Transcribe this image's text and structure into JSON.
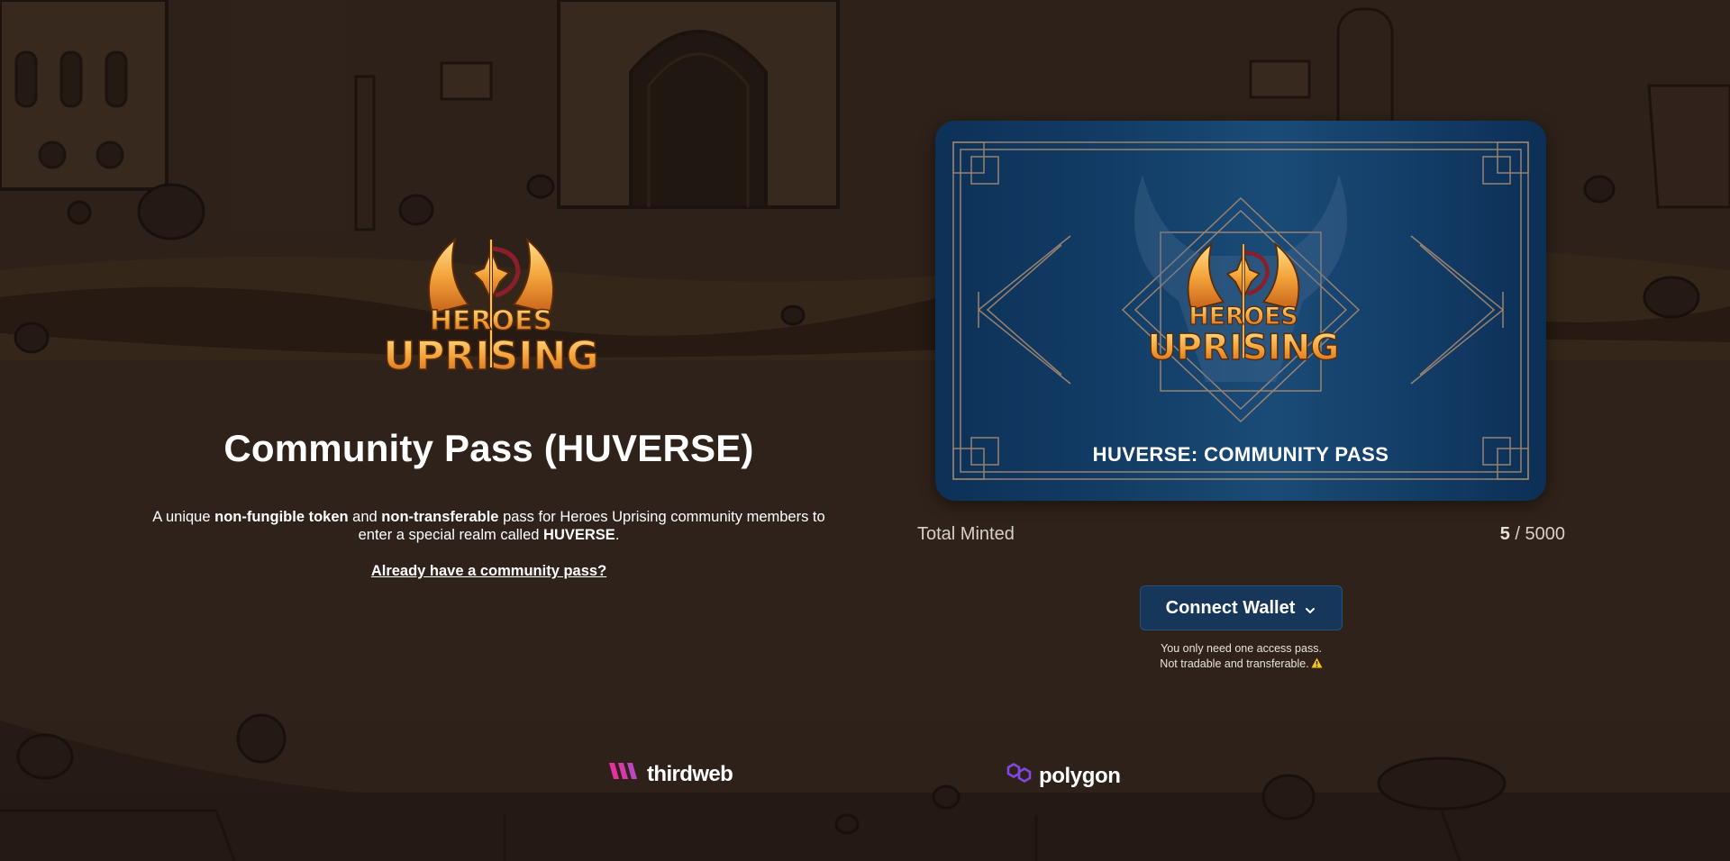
{
  "hero": {
    "logo_icon": "heroes-uprising-logo",
    "logo_text_line1": "HEROES",
    "logo_text_line2": "UPRISING",
    "title": "Community Pass (HUVERSE)",
    "description": {
      "part1": "A unique ",
      "bold1": "non-fungible token",
      "part2": " and ",
      "bold2": "non-transferable",
      "part3": " pass for Heroes Uprising community members to enter a special realm called ",
      "bold3": "HUVERSE",
      "part4": "."
    },
    "already_link": "Already have a community pass?"
  },
  "pass_card": {
    "caption": "HUVERSE: COMMUNITY PASS",
    "logo_text_line1": "HEROES",
    "logo_text_line2": "UPRISING"
  },
  "minted": {
    "label": "Total Minted",
    "count": "5",
    "separator": " / ",
    "total": "5000"
  },
  "wallet": {
    "button_label": "Connect Wallet",
    "chevron_icon": "chevron-down-icon",
    "note_line1": "You only need one access pass.",
    "note_line2": "Not tradable and transferable.",
    "warning_icon": "warning-icon"
  },
  "footer": {
    "thirdweb_label": "thirdweb",
    "thirdweb_icon": "thirdweb-logo-icon",
    "polygon_label": "polygon",
    "polygon_icon": "polygon-logo-icon"
  },
  "colors": {
    "background": "#2a1f18",
    "card_blue": "#123d66",
    "button_blue": "#16365a",
    "logo_gold": "#f0a23a",
    "thirdweb_pink": "#e62fa0",
    "polygon_purple": "#8247e5"
  }
}
